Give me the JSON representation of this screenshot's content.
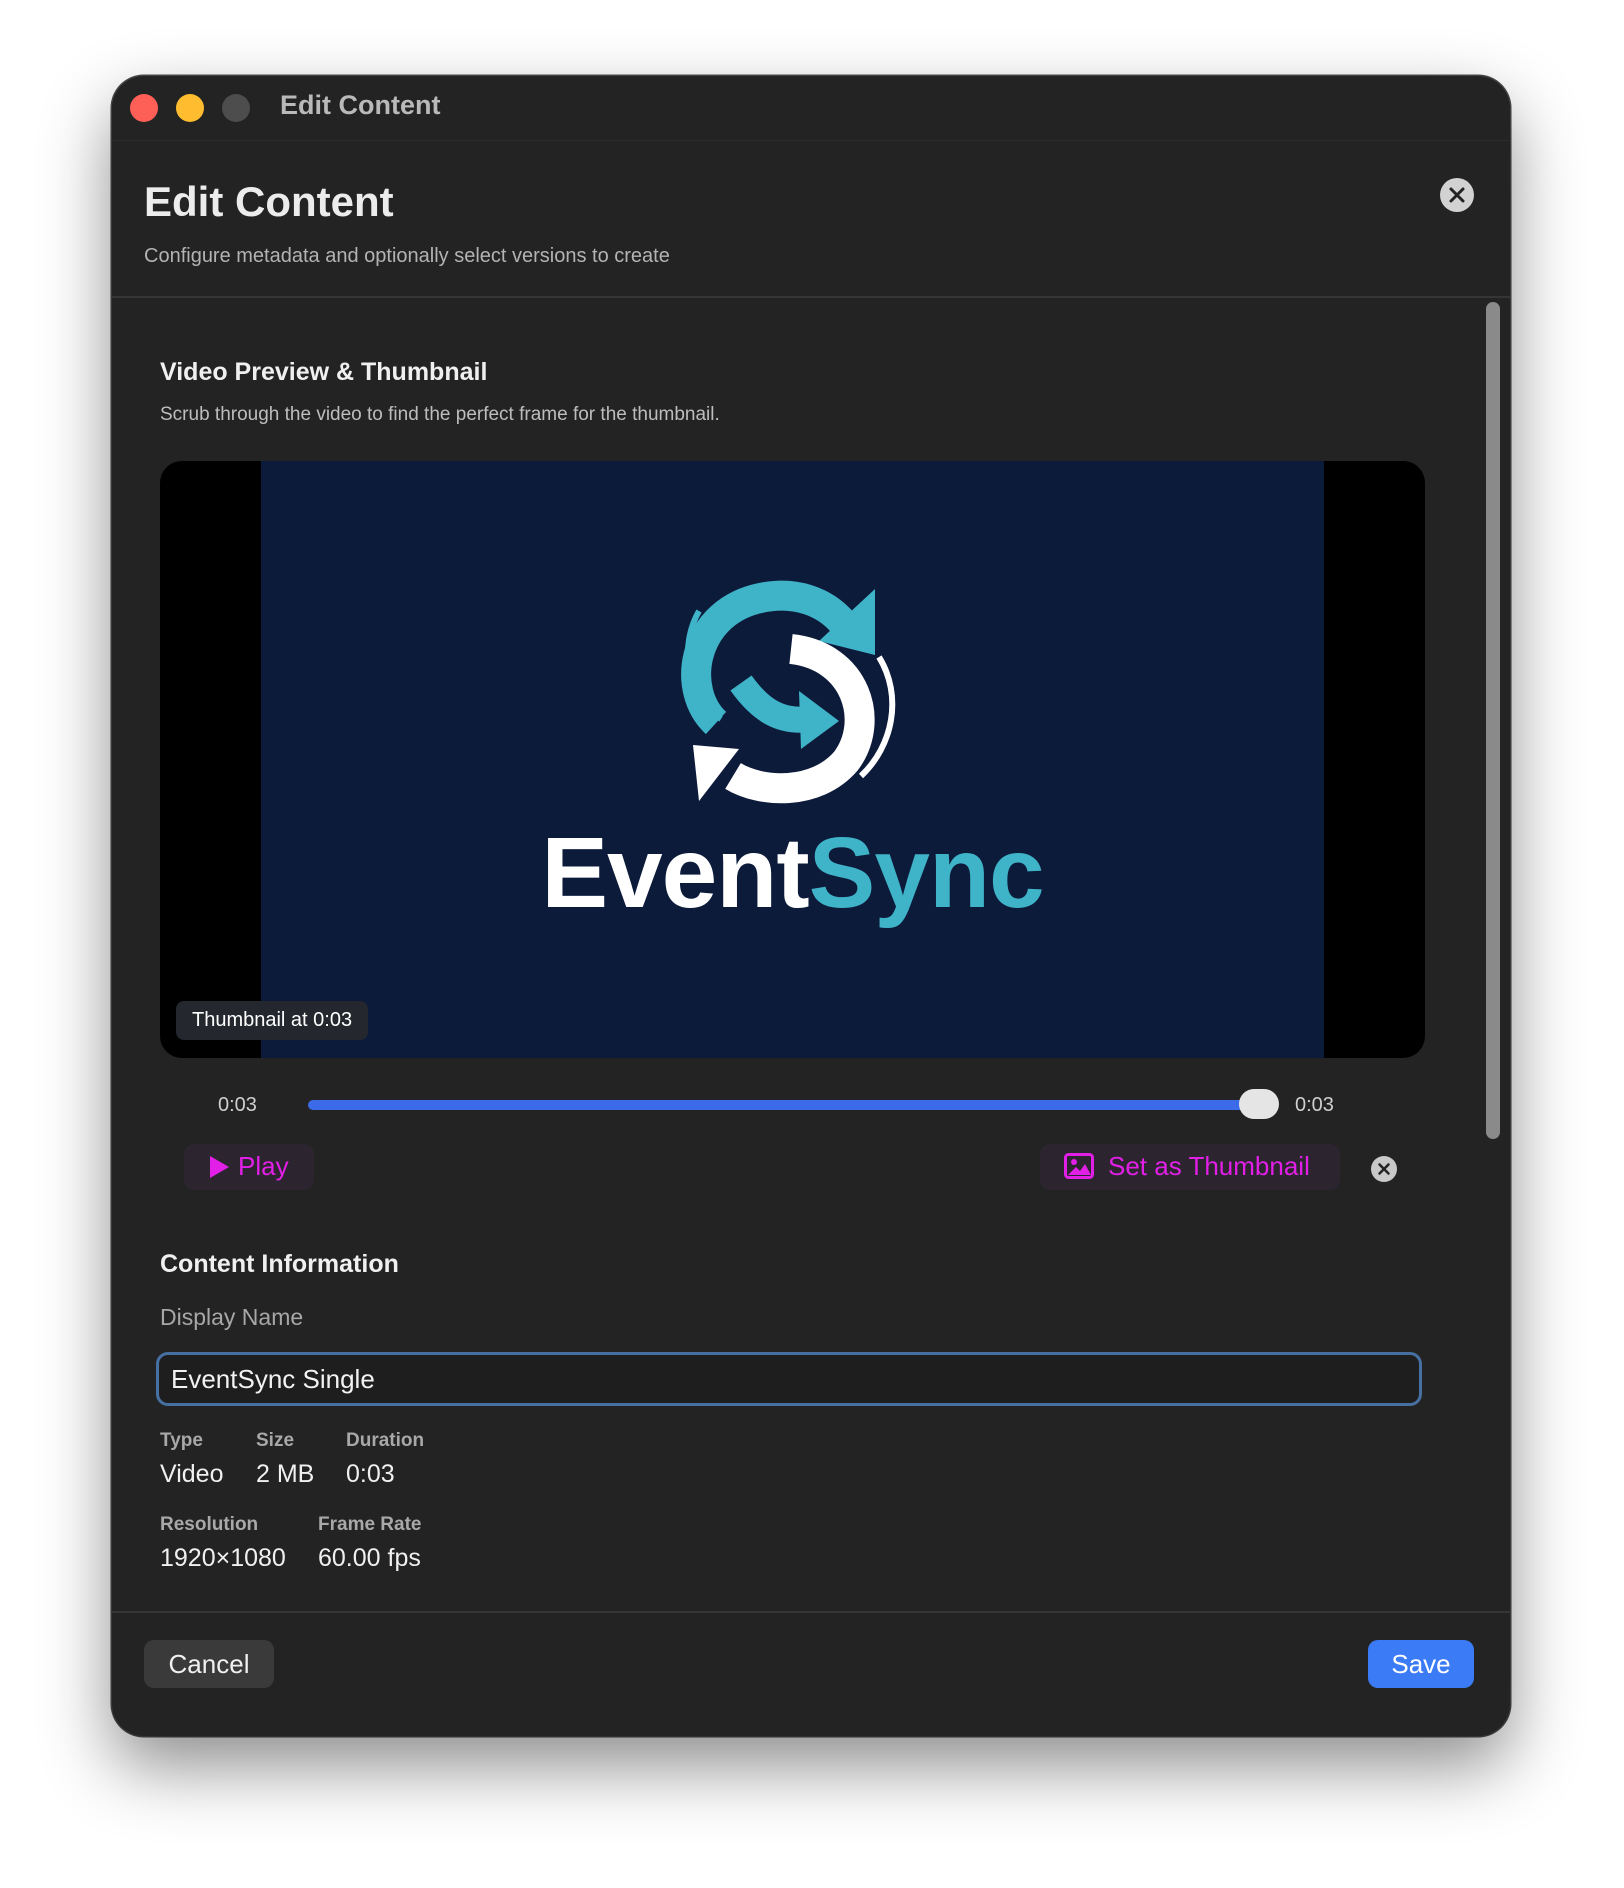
{
  "window": {
    "title": "Edit Content"
  },
  "header": {
    "title": "Edit Content",
    "subtitle": "Configure metadata and optionally select versions to create"
  },
  "preview": {
    "title": "Video Preview & Thumbnail",
    "description": "Scrub through the video to find the perfect frame for the thumbnail.",
    "brand_part1": "Event",
    "brand_part2": "Sync",
    "badge": "Thumbnail at 0:03",
    "current_time": "0:03",
    "duration": "0:03",
    "scrub_position_fraction": 1.0,
    "play_label": "Play",
    "set_thumbnail_label": "Set as Thumbnail"
  },
  "content": {
    "title": "Content Information",
    "display_name_label": "Display Name",
    "display_name_value": "EventSync Single",
    "type_label": "Type",
    "type_value": "Video",
    "size_label": "Size",
    "size_value": "2 MB",
    "duration_label": "Duration",
    "duration_value": "0:03",
    "resolution_label": "Resolution",
    "resolution_value": "1920×1080",
    "frame_rate_label": "Frame Rate",
    "frame_rate_value": "60.00 fps"
  },
  "footer": {
    "cancel_label": "Cancel",
    "save_label": "Save"
  },
  "icons": {
    "close": "close-icon",
    "clear": "clear-icon",
    "play": "play-icon",
    "thumbnail": "photo-icon",
    "logo": "sync-arrows-icon"
  },
  "colors": {
    "accent": "#3b7cf6",
    "magenta": "#e21fe6",
    "brand_teal": "#3fb3c8",
    "video_bg": "#0d1b3b"
  }
}
